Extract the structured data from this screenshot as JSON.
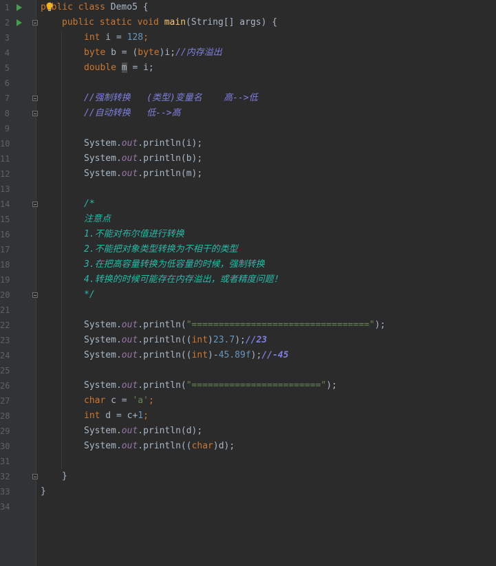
{
  "editor": {
    "line_numbers": [
      "1",
      "2",
      "3",
      "4",
      "5",
      "6",
      "7",
      "8",
      "9",
      "10",
      "11",
      "12",
      "13",
      "14",
      "15",
      "16",
      "17",
      "18",
      "19",
      "20",
      "21",
      "22",
      "23",
      "24",
      "25",
      "26",
      "27",
      "28",
      "29",
      "30",
      "31",
      "32",
      "33",
      "34"
    ],
    "lines": {
      "l1_kw1": "public",
      "l1_kw2": "class",
      "l1_name": "Demo5 {",
      "l2_kw": "public static void",
      "l2_fn": "main",
      "l2_rest": "(String[] args) {",
      "l3_type": "int",
      "l3_rest": " i = ",
      "l3_num": "128",
      "l3_end": ";",
      "l4_type": "byte",
      "l4_rest1": " b = (",
      "l4_cast": "byte",
      "l4_rest2": ")i;",
      "l4_comment": "//内存溢出",
      "l5_type": "double",
      "l5_var": "m",
      "l5_rest": " = i;",
      "l7_comment": "//强制转换   (类型)变量名    高-->低",
      "l8_comment": "//自动转换   低-->高",
      "l10_sys": "System.",
      "l10_out": "out",
      "l10_rest": ".println(i);",
      "l11_sys": "System.",
      "l11_out": "out",
      "l11_rest": ".println(b);",
      "l12_sys": "System.",
      "l12_out": "out",
      "l12_rest": ".println(m);",
      "l14_doc": "/*",
      "l15_doc": "注意点",
      "l16_doc": "1.不能对布尔值进行转换",
      "l17_doc": "2.不能把对象类型转换为不相干的类型",
      "l18_doc": "3.在把高容量转换为低容量的时候，强制转换",
      "l19_doc": "4.转换的时候可能存在内存溢出，或者精度问题！",
      "l20_doc": "*/",
      "l22_sys": "System.",
      "l22_out": "out",
      "l22_rest1": ".println(",
      "l22_str": "\"=================================\"",
      "l22_rest2": ");",
      "l23_sys": "System.",
      "l23_out": "out",
      "l23_rest1": ".println((",
      "l23_kw": "int",
      "l23_rest2": ")",
      "l23_num": "23.7",
      "l23_rest3": ");",
      "l23_comment": "//23",
      "l24_sys": "System.",
      "l24_out": "out",
      "l24_rest1": ".println((",
      "l24_kw": "int",
      "l24_rest2": ")-",
      "l24_num": "45.89f",
      "l24_rest3": ");",
      "l24_comment": "//-45",
      "l26_sys": "System.",
      "l26_out": "out",
      "l26_rest1": ".println(",
      "l26_str": "\"========================\"",
      "l26_rest2": ");",
      "l27_type": "char",
      "l27_rest": " c = ",
      "l27_str": "'a'",
      "l27_end": ";",
      "l28_type": "int",
      "l28_rest": " d = c+",
      "l28_num": "1",
      "l28_end": ";",
      "l29_sys": "System.",
      "l29_out": "out",
      "l29_rest": ".println(d);",
      "l30_sys": "System.",
      "l30_out": "out",
      "l30_rest1": ".println((",
      "l30_kw": "char",
      "l30_rest2": ")d);",
      "l32_brace": "}",
      "l33_brace": "}"
    }
  },
  "colors": {
    "background": "#2b2b2b",
    "gutter": "#313335",
    "keyword": "#cc7832",
    "function": "#ffc66d",
    "number": "#6897bb",
    "string": "#6a8759",
    "field": "#9876aa",
    "doc_comment": "#2bb8a8",
    "line_comment": "#7f7fe0",
    "run_icon": "#499c54"
  },
  "icons": [
    "run-icon",
    "fold-icon",
    "lightbulb-icon"
  ]
}
